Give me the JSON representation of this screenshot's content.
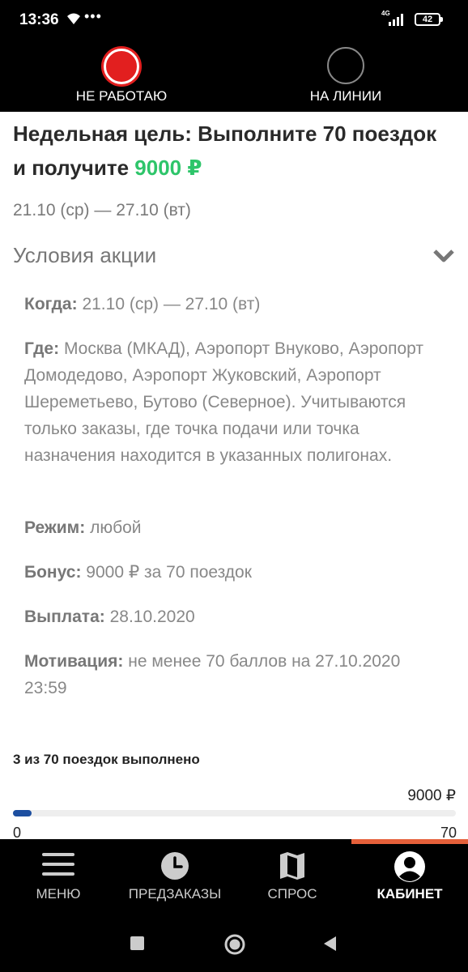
{
  "status_bar": {
    "time": "13:36",
    "dots": "•••",
    "network": "4G",
    "battery": "42"
  },
  "driver_state": {
    "off_label": "НЕ РАБОТАЮ",
    "on_label": "НА ЛИНИИ",
    "off_color": "#e21f1f"
  },
  "goal": {
    "title": "Недельная цель: Выполните 70 поездок и получите",
    "amount": "9000 ₽",
    "amount_color": "#2ec56a",
    "period": "21.10 (ср) — 27.10 (вт)"
  },
  "conditions": {
    "header": "Условия акции",
    "when_label": "Когда:",
    "when_value": "21.10 (ср) — 27.10 (вт)",
    "where_label": "Где:",
    "where_value": "Москва (МКАД), Аэропорт Внуково, Аэропорт Домодедово, Аэропорт Жуковский, Аэропорт Шереметьево, Бутово (Северное). Учитываются только заказы, где точка подачи или точка назначения находится в указанных полигонах.",
    "mode_label": "Режим:",
    "mode_value": "любой",
    "bonus_label": "Бонус:",
    "bonus_value": "9000 ₽ за 70 поездок",
    "payout_label": "Выплата:",
    "payout_value": "28.10.2020",
    "motivation_label": "Мотивация:",
    "motivation_value": "не менее 70 баллов на 27.10.2020 23:59"
  },
  "progress": {
    "caption": "3 из 70 поездок выполнено",
    "reward": "9000 ₽",
    "start": "0",
    "end": "70",
    "done": 3,
    "total": 70,
    "fill_color": "#1d4fa0"
  },
  "bottom_nav": {
    "items": [
      {
        "label": "МЕНЮ",
        "icon": "menu-icon"
      },
      {
        "label": "ПРЕДЗАКАЗЫ",
        "icon": "clock-icon"
      },
      {
        "label": "СПРОС",
        "icon": "map-icon"
      },
      {
        "label": "КАБИНЕТ",
        "icon": "account-icon"
      }
    ],
    "active": 3,
    "accent_color": "#e5603a"
  }
}
